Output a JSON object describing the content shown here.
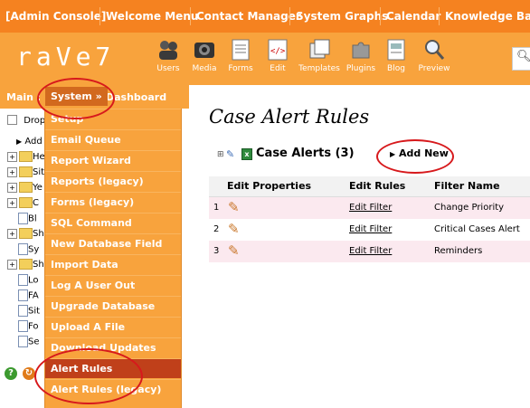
{
  "topnav": {
    "items": [
      "[Admin Console]",
      "Welcome Menu",
      "Contact Manager",
      "System Graphs",
      "Calendar",
      "Knowledge Base"
    ]
  },
  "header": {
    "logo": "raVe7",
    "tools": [
      {
        "label": "Users",
        "icon": "users-icon"
      },
      {
        "label": "Media",
        "icon": "camera-icon"
      },
      {
        "label": "Forms",
        "icon": "form-icon"
      },
      {
        "label": "Edit",
        "icon": "edit-code-icon"
      },
      {
        "label": "Templates",
        "icon": "templates-icon"
      },
      {
        "label": "Plugins",
        "icon": "puzzle-icon"
      },
      {
        "label": "Blog",
        "icon": "blog-icon"
      },
      {
        "label": "Preview",
        "icon": "magnifier-icon"
      }
    ]
  },
  "leftbar": {
    "main": "Main :",
    "system": "System »",
    "dashboard": "Dashboard"
  },
  "tree": {
    "drop": "Drop",
    "add": "Add",
    "items": [
      "He",
      "Sit",
      "Ye",
      "C",
      "Bl",
      "Sh",
      "Sy",
      "Sh",
      "Lo",
      "FA",
      "Sit",
      "Fo",
      "Se"
    ]
  },
  "system_menu": {
    "items": [
      "Setup",
      "Email Queue",
      "Report Wizard",
      "Reports (legacy)",
      "Forms (legacy)",
      "SQL Command",
      "New Database Field",
      "Import Data",
      "Log A User Out",
      "Upgrade Database",
      "Upload A File",
      "Download Updates",
      "Alert Rules",
      "Alert Rules (legacy)"
    ],
    "active": "Alert Rules"
  },
  "main": {
    "title": "Case Alert Rules",
    "section": "Case Alerts (3)",
    "add_new": "Add New",
    "columns": [
      "Edit Properties",
      "Edit Rules",
      "Filter Name"
    ],
    "rows": [
      {
        "num": "1",
        "edit_rules": "Edit Filter",
        "filter_name": "Change Priority"
      },
      {
        "num": "2",
        "edit_rules": "Edit Filter",
        "filter_name": "Critical Cases Alert"
      },
      {
        "num": "3",
        "edit_rules": "Edit Filter",
        "filter_name": "Reminders"
      }
    ]
  },
  "colors": {
    "topnav": "#f58220",
    "header": "#f8a33d",
    "active_menu": "#c0401a",
    "annotation": "#d7191c",
    "row_pink": "#fbe9ef"
  }
}
